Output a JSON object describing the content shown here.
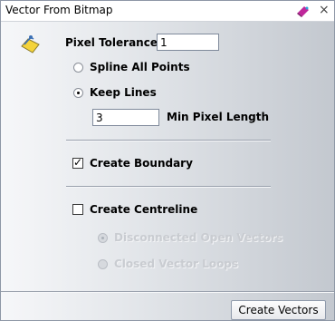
{
  "window": {
    "title": "Vector From Bitmap",
    "close_glyph": "×"
  },
  "icons": {
    "tool": "vector-from-bitmap-icon",
    "pin": "pin-icon",
    "close": "close-icon"
  },
  "form": {
    "pixel_tolerance_label": "Pixel Tolerance:",
    "pixel_tolerance_value": "1",
    "spline_all_points": "Spline All Points",
    "keep_lines": "Keep Lines",
    "min_pixel_length_value": "3",
    "min_pixel_length_label": "Min Pixel Length",
    "create_boundary": "Create Boundary",
    "create_centreline": "Create Centreline",
    "disconnected_open_vectors": "Disconnected Open Vectors",
    "closed_vector_loops": "Closed Vector Loops"
  },
  "state": {
    "mode": "keep_lines",
    "create_boundary": true,
    "create_centreline": false,
    "centreline_mode": "disconnected_open_vectors"
  },
  "buttons": {
    "create_vectors": "Create Vectors"
  }
}
